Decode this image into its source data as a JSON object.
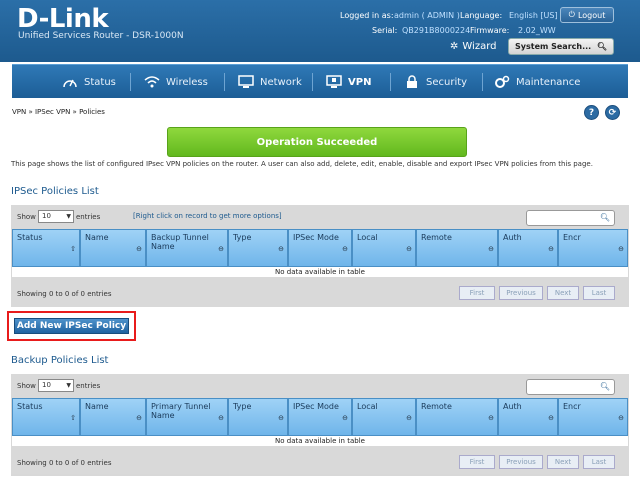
{
  "header": {
    "logo": "D-Link",
    "subtitle": "Unified Services Router - DSR-1000N",
    "logged_in_label": "Logged in as:",
    "logged_in_value": "admin ( ADMIN )",
    "language_label": "Language:",
    "language_value": "English [US]",
    "logout_label": "Logout",
    "serial_label": "Serial:",
    "serial_value": "QB291B8000224",
    "firmware_label": "Firmware:",
    "firmware_value": "2.02_WW",
    "wizard_label": "Wizard",
    "search_placeholder": "System Search..."
  },
  "nav": {
    "items": [
      {
        "label": "Status",
        "icon": "gauge-icon"
      },
      {
        "label": "Wireless",
        "icon": "wifi-icon"
      },
      {
        "label": "Network",
        "icon": "monitor-icon"
      },
      {
        "label": "VPN",
        "icon": "vpn-icon",
        "active": true
      },
      {
        "label": "Security",
        "icon": "lock-icon"
      },
      {
        "label": "Maintenance",
        "icon": "gears-icon"
      }
    ]
  },
  "breadcrumb": "VPN  »  IPSec VPN  »  Policies",
  "alert": "Operation Succeeded",
  "description": "This page shows the list of configured IPsec VPN policies on the router. A user can also add, delete, edit, enable, disable and export IPsec VPN policies from this page.",
  "ipsec": {
    "title": "IPSec Policies List",
    "show_label": "Show",
    "entries_value": "10",
    "entries_label": "entries",
    "hint": "[Right click on record to get more options]",
    "columns": [
      "Status",
      "Name",
      "Backup Tunnel Name",
      "Type",
      "IPSec Mode",
      "Local",
      "Remote",
      "Auth",
      "Encr"
    ],
    "nodata": "No data available in table",
    "showing": "Showing 0 to 0 of 0 entries",
    "pager": [
      "First",
      "Previous",
      "Next",
      "Last"
    ]
  },
  "add_button": "Add New IPSec Policy",
  "backup": {
    "title": "Backup Policies List",
    "show_label": "Show",
    "entries_value": "10",
    "entries_label": "entries",
    "columns": [
      "Status",
      "Name",
      "Primary Tunnel Name",
      "Type",
      "IPSec Mode",
      "Local",
      "Remote",
      "Auth",
      "Encr"
    ],
    "nodata": "No data available in table",
    "showing": "Showing 0 to 0 of 0 entries",
    "pager": [
      "First",
      "Previous",
      "Next",
      "Last"
    ]
  }
}
